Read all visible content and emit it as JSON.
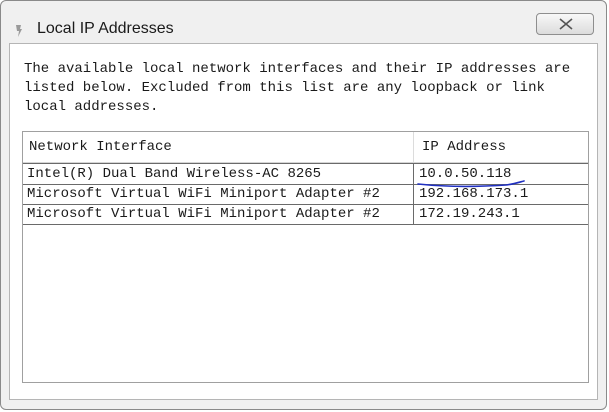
{
  "window": {
    "title": "Local IP Addresses",
    "close_icon": "close-icon",
    "app_icon": "app-icon"
  },
  "description": "The available local network interfaces and their IP addresses are listed below.  Excluded from this list are any loopback or link local addresses.",
  "table": {
    "columns": [
      "Network Interface",
      "IP Address"
    ],
    "rows": [
      {
        "interface": "Intel(R) Dual Band Wireless-AC 8265",
        "ip": "10.0.50.118"
      },
      {
        "interface": "Microsoft Virtual WiFi Miniport Adapter #2",
        "ip": "192.168.173.1"
      },
      {
        "interface": "Microsoft Virtual WiFi Miniport Adapter #2",
        "ip": "172.19.243.1"
      }
    ]
  },
  "colors": {
    "highlight_underline": "#1f2fc0"
  }
}
